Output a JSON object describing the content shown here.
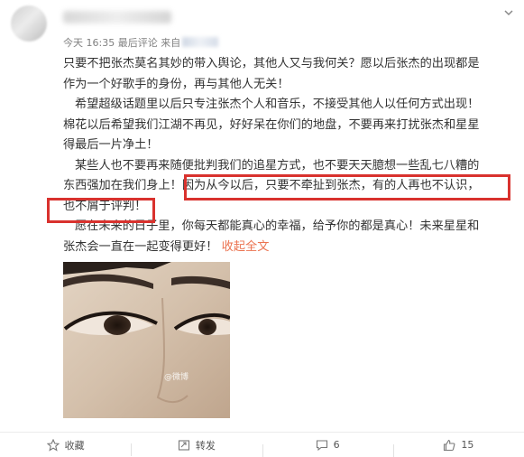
{
  "post": {
    "meta_time": "今天 16:35",
    "meta_last_comment": "最后评论",
    "meta_from": "来自",
    "lines": [
      "只要不把张杰莫名其妙的带入舆论，其他人又与我何关？愿以后张杰的出现都是",
      "作为一个好歌手的身份，再与其他人无关！",
      "希望超级话题里以后只专注张杰个人和音乐，不接受其他人以任何方式出现！",
      "棉花以后希望我们江湖不再见，好好呆在你们的地盘，不要再来打扰张杰和星星",
      "得最后一片净土！",
      "某些人也不要再来随便批判我们的追星方式，也不要天天臆想一些乱七八糟的",
      "东西强加在我们身上！因为从今以后，只要不牵扯到张杰，有的人再也不认识，",
      "也不屑于评判！",
      "愿在未来的日子里，你每天都能真心的幸福，给予你的都是真心！未来星星和",
      "张杰会一直在一起变得更好！"
    ],
    "collapse_link": "收起全文",
    "watermark": "@微博"
  },
  "toolbar": {
    "favorite_label": "收藏",
    "repost_label": "转发",
    "comment_count": "6",
    "like_count": "15"
  },
  "colors": {
    "highlight": "#d9322e",
    "link": "#eb7350",
    "meta": "#808080"
  }
}
